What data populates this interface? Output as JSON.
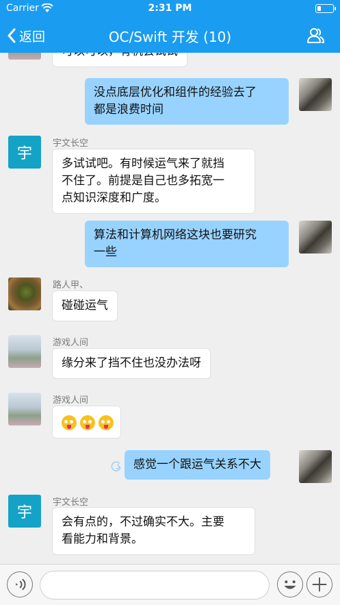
{
  "status_bar": {
    "carrier": "Carrier",
    "time": "2:31 PM"
  },
  "nav": {
    "back_label": "返回",
    "title": "OC/Swift 开发 (10)"
  },
  "colors": {
    "nav_bar": "#1a9cf0",
    "self_bubble": "#98d3ff",
    "other_bubble": "#ffffff",
    "avatar_text_bg": "#14a3c7"
  },
  "messages": [
    {
      "from": "other",
      "sender": "",
      "avatar": "photo-sky",
      "lines": [
        "可以可以，有机会试试"
      ]
    },
    {
      "from": "self",
      "avatar": "photo-rock",
      "lines": [
        "没点底层优化和组件的经验去了",
        "都是浪费时间"
      ]
    },
    {
      "from": "other",
      "sender": "宇文长空",
      "avatar_text": "宇",
      "lines": [
        "多试试吧。有时候运气来了就挡",
        "不住了。前提是自己也多拓宽一",
        "点知识深度和广度。"
      ]
    },
    {
      "from": "self",
      "avatar": "photo-rock",
      "lines": [
        "算法和计算机网络这块也要研究",
        "一些"
      ]
    },
    {
      "from": "other",
      "sender": "路人甲、",
      "avatar": "photo-tree",
      "lines": [
        "碰碰运气"
      ]
    },
    {
      "from": "other",
      "sender": "游戏人间",
      "avatar": "photo-sky",
      "lines": [
        "缘分来了挡不住也没办法呀"
      ]
    },
    {
      "from": "other",
      "sender": "游戏人间",
      "avatar": "photo-sky",
      "emoji_count": 3,
      "emoji_icon": "crazy-face-emoji"
    },
    {
      "from": "self",
      "avatar": "photo-rock",
      "lines": [
        "感觉一个跟运气关系不大"
      ],
      "status_icon": "resend-icon"
    },
    {
      "from": "other",
      "sender": "宇文长空",
      "avatar_text": "宇",
      "lines": [
        "会有点的，不过确实不大。主要",
        "看能力和背景。"
      ]
    }
  ],
  "composer": {
    "voice_icon": "voice-icon",
    "emoji_icon": "emoji-icon",
    "add_icon": "add-icon",
    "input_value": ""
  }
}
